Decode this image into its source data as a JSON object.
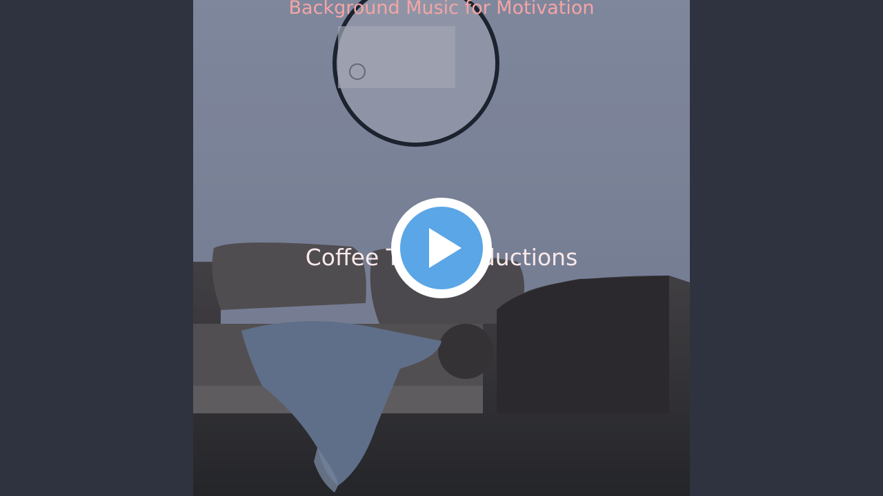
{
  "video": {
    "top_title": "Background Music for Motivation",
    "center_title": "Coffee Table Seductions",
    "play_icon": "play-icon",
    "play_button_color": "#5aa6e6"
  },
  "colors": {
    "background": "#2f3340",
    "top_title": "#f4a5a5",
    "center_title": "#fbe9ea"
  }
}
